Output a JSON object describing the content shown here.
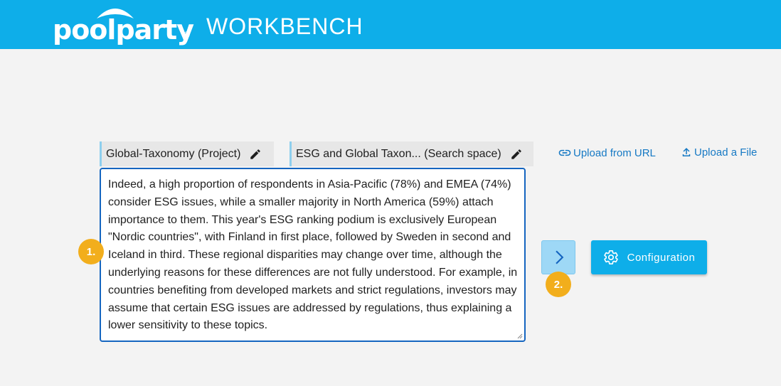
{
  "header": {
    "logo_text": "poolparty",
    "logo_reg": "®",
    "app_title": "WORKBENCH"
  },
  "chips": [
    {
      "label": "Global-Taxonomy (Project)",
      "icon": "pencil-icon"
    },
    {
      "label": "ESG and Global Taxon... (Search space)",
      "icon": "pencil-icon"
    }
  ],
  "links": {
    "upload_url": {
      "label": "Upload from URL",
      "icon": "link-icon"
    },
    "upload_file": {
      "label": "Upload a File",
      "icon": "upload-icon"
    }
  },
  "editor": {
    "text": "Indeed, a high proportion of respondents in Asia-Pacific (78%) and EMEA (74%) consider ESG issues, while a smaller majority in North America (59%) attach importance to them. This year's ESG ranking podium is exclusively European \"Nordic countries\", with Finland in first place, followed by Sweden in second and Iceland in third. These regional disparities may change over time, although the underlying reasons for these differences are not fully understood. For example, in countries benefiting from developed markets and strict regulations, investors may assume that certain ESG issues are addressed by regulations, thus explaining a lower sensitivity to these topics."
  },
  "steps": {
    "step1": "1.",
    "step2": "2."
  },
  "actions": {
    "next_icon": "chevron-right-icon",
    "config_label": "Configuration",
    "config_icon": "gear-icon"
  },
  "colors": {
    "brand": "#0eaee9",
    "link": "#1679c4",
    "badge": "#f2ae1c",
    "editor_border": "#1565c0"
  }
}
